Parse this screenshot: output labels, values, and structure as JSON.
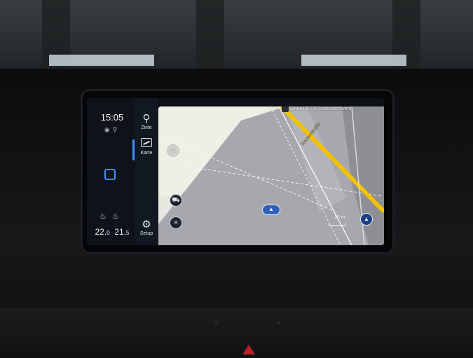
{
  "status_bar": {
    "clock": "15:05",
    "icons": [
      "connectivity-icon",
      "pedestrian-icon"
    ],
    "home_button_color": "#3b8fff",
    "temperature_left_main": "22.",
    "temperature_left_decimal": "0",
    "temperature_right_main": "21.",
    "temperature_right_decimal": "5"
  },
  "menu": {
    "items": [
      {
        "label": "Ziele",
        "icon": "search-icon",
        "active": false
      },
      {
        "label": "Karte",
        "icon": "map-icon",
        "active": true
      },
      {
        "label": "Setup",
        "icon": "gear-icon",
        "active": false
      }
    ]
  },
  "map": {
    "poi_label": "GmbH & Co. Kunststoffwerk",
    "street_name": "Rosenstraße",
    "scale_label": "10 m",
    "accent_color": "#3b8fff",
    "road_color": "#f2c200"
  }
}
